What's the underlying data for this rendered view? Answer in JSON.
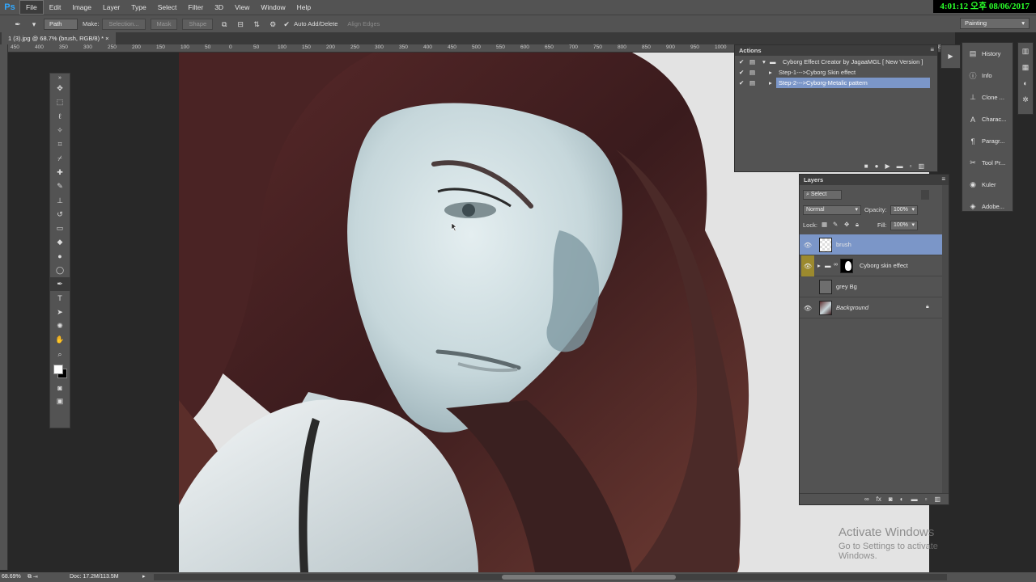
{
  "app": {
    "logo": "Ps"
  },
  "menubar": {
    "items": [
      "File",
      "Edit",
      "Image",
      "Layer",
      "Type",
      "Select",
      "Filter",
      "3D",
      "View",
      "Window",
      "Help"
    ],
    "active_index": 0
  },
  "clock": {
    "text": "4:01:12 오후 08/06/2017"
  },
  "options": {
    "mode_value": "Path",
    "make_label": "Make:",
    "selection_button": "Selection...",
    "mask_button": "Mask",
    "shape_button": "Shape",
    "auto_add_delete_checked": true,
    "auto_add_delete_label": "Auto Add/Delete",
    "align_edges_label": "Align Edges",
    "workspace": "Painting"
  },
  "document": {
    "tab_title": "1 (3).jpg @ 68.7% (brush, RGB/8) *",
    "ruler_ticks": [
      "450",
      "400",
      "350",
      "300",
      "250",
      "200",
      "150",
      "100",
      "50",
      "0",
      "50",
      "100",
      "150",
      "200",
      "250",
      "300",
      "350",
      "400",
      "450",
      "500",
      "550",
      "600",
      "650",
      "700",
      "750",
      "800",
      "850",
      "900",
      "950",
      "1000",
      "1050",
      "1100",
      "1150",
      "1200",
      "1250",
      "1300",
      "1350",
      "1400",
      "1450"
    ]
  },
  "actions_panel": {
    "title": "Actions",
    "rows": [
      {
        "label": "Cyborg Effect Creator by JagaaMGL [ New Version ]",
        "type": "set",
        "selected": false
      },
      {
        "label": "Step-1--->Cyborg Skin effect",
        "type": "action",
        "selected": false
      },
      {
        "label": "Step-2--->Cyborg-Metalic pattern",
        "type": "action",
        "selected": true
      }
    ]
  },
  "layers_panel": {
    "title": "Layers",
    "filter_placeholder": "Select",
    "blend_mode": "Normal",
    "opacity_label": "Opacity:",
    "opacity_value": "100%",
    "lock_label": "Lock:",
    "fill_label": "Fill:",
    "fill_value": "100%",
    "layers": [
      {
        "name": "brush",
        "visible": true,
        "selected": true,
        "italic": false
      },
      {
        "name": "Cyborg skin effect",
        "visible": true,
        "selected": false,
        "italic": false,
        "group": true
      },
      {
        "name": "grey Bg",
        "visible": false,
        "selected": false,
        "italic": false
      },
      {
        "name": "Background",
        "visible": true,
        "selected": false,
        "italic": true,
        "locked": true
      }
    ]
  },
  "right_dock": {
    "items": [
      {
        "label": "History",
        "icon": "history-icon"
      },
      {
        "label": "Info",
        "icon": "info-icon"
      },
      {
        "label": "Clone ...",
        "icon": "clone-source-icon"
      },
      {
        "label": "Charac...",
        "icon": "character-icon"
      },
      {
        "label": "Paragr...",
        "icon": "paragraph-icon"
      },
      {
        "label": "Tool Pr...",
        "icon": "tool-presets-icon"
      },
      {
        "label": "Kuler",
        "icon": "kuler-icon"
      },
      {
        "label": "Adobe...",
        "icon": "adobe-icon"
      }
    ]
  },
  "status": {
    "zoom": "68.69%",
    "doc": "Doc: 17.2M/113.5M"
  },
  "watermark": {
    "line1": "Activate Windows",
    "line2": "Go to Settings to activate Windows."
  },
  "colors": {
    "ui_gray": "#535353",
    "selection_blue": "#7b96c8",
    "clock_green": "#2aff2a",
    "ps_blue": "#31a8ff"
  }
}
